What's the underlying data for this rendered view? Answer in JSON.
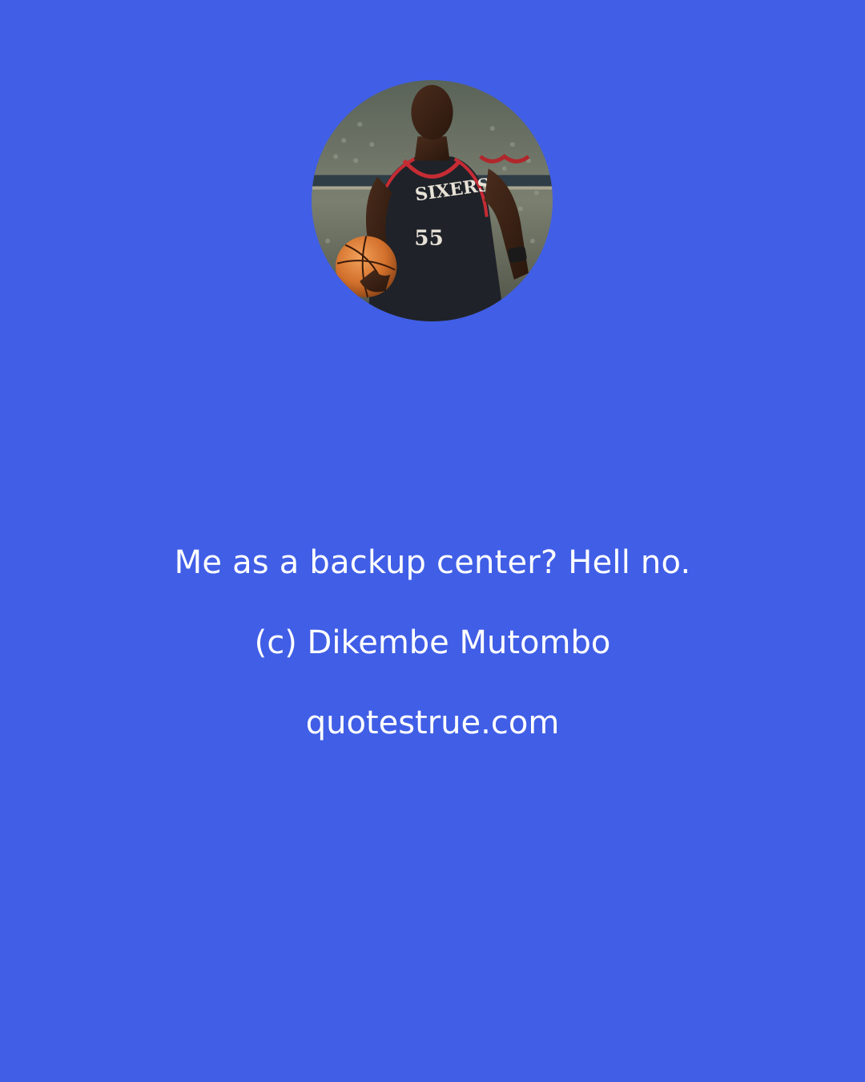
{
  "background_color": "#405ee6",
  "portrait": {
    "icon": "basketball-player-portrait",
    "jersey_wordmark": "SIXERS",
    "jersey_number": "55"
  },
  "quote": {
    "text": "Me as a backup center? Hell no.",
    "author": "(c) Dikembe Mutombo",
    "source": "quotestrue.com"
  }
}
